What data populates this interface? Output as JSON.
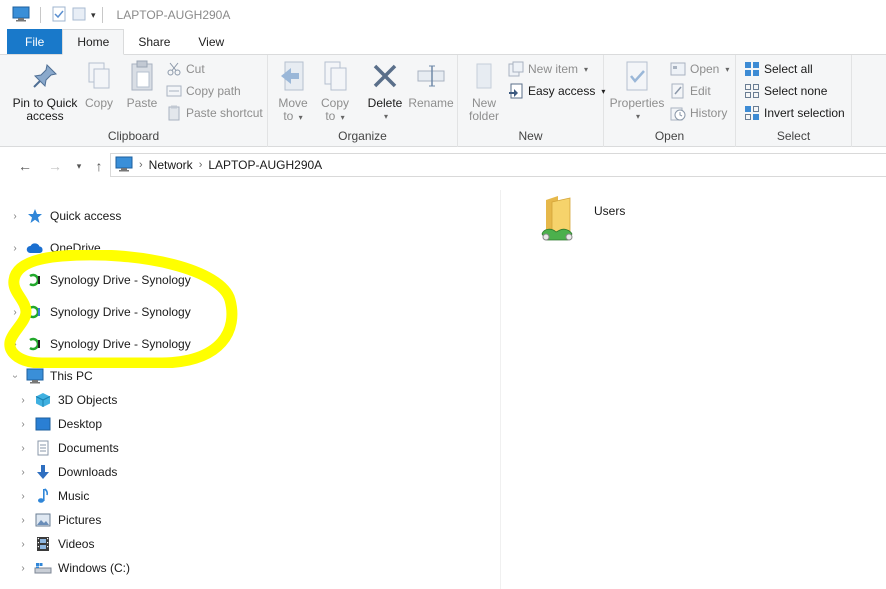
{
  "window": {
    "title": "LAPTOP-AUGH290A"
  },
  "ribbon_tabs": [
    {
      "label": "File"
    },
    {
      "label": "Home"
    },
    {
      "label": "Share"
    },
    {
      "label": "View"
    }
  ],
  "ribbon": {
    "clipboard": {
      "label": "Clipboard",
      "pin_line1": "Pin to Quick",
      "pin_line2": "access",
      "copy": "Copy",
      "paste": "Paste",
      "cut": "Cut",
      "copy_path": "Copy path",
      "paste_shortcut": "Paste shortcut"
    },
    "organize": {
      "label": "Organize",
      "move_line1": "Move",
      "move_line2": "to",
      "copy_line1": "Copy",
      "copy_line2": "to",
      "delete": "Delete",
      "rename": "Rename"
    },
    "new": {
      "label": "New",
      "folder_line1": "New",
      "folder_line2": "folder",
      "new_item": "New item",
      "easy_access": "Easy access"
    },
    "open": {
      "label": "Open",
      "properties": "Properties",
      "open": "Open",
      "edit": "Edit",
      "history": "History"
    },
    "select": {
      "label": "Select",
      "select_all": "Select all",
      "select_none": "Select none",
      "invert": "Invert selection"
    }
  },
  "address": {
    "crumbs": [
      "Network",
      "LAPTOP-AUGH290A"
    ]
  },
  "nav_pane": {
    "quick_access": "Quick access",
    "onedrive": "OneDrive",
    "synology": [
      "Synology Drive - Synology",
      "Synology Drive - Synology",
      "Synology Drive - Synology"
    ],
    "this_pc": "This PC",
    "pc_children": [
      "3D Objects",
      "Desktop",
      "Documents",
      "Downloads",
      "Music",
      "Pictures",
      "Videos",
      "Windows (C:)"
    ]
  },
  "content": {
    "items": [
      {
        "name": "Users"
      }
    ]
  },
  "colors": {
    "file_tab": "#1979ca",
    "highlight": "#ffff00",
    "folder": "#f2c94c",
    "synology_green": "#22a82c"
  }
}
